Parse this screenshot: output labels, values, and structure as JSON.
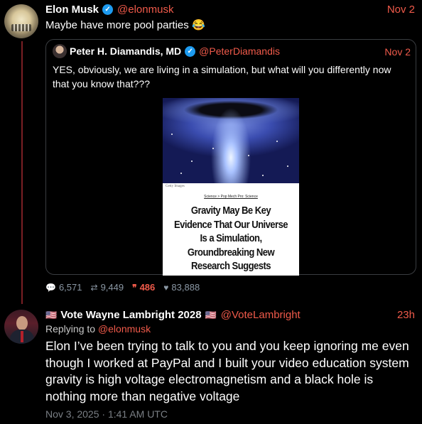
{
  "colors": {
    "accent": "#f05a4a",
    "verified": "#1d9bf0",
    "thread_line": "#7a1f24"
  },
  "main_post": {
    "name": "Elon Musk",
    "handle": "@elonmusk",
    "date": "Nov 2",
    "text": "Maybe have more pool parties 😂"
  },
  "quoted_post": {
    "name": "Peter H. Diamandis, MD",
    "handle": "@PeterDiamandis",
    "date": "Nov 2",
    "text": "YES, obviously, we are living in a simulation, but what will you differently now that you know that???",
    "article": {
      "credit": "Getty Images",
      "breadcrumb": "Science > Pop Mech Pro: Science",
      "headline": "Gravity May Be Key Evidence That Our Universe Is a Simulation, Groundbreaking New Research Suggests"
    }
  },
  "stats": {
    "replies": "6,571",
    "reposts": "9,449",
    "quotes": "486",
    "likes": "83,888"
  },
  "reply_post": {
    "flag_left": "🇺🇸",
    "name": "Vote Wayne Lambright 2028",
    "flag_right": "🇺🇸",
    "handle": "@VoteLambright",
    "date": "23h",
    "replying_to_prefix": "Replying to",
    "replying_to_handle": "@elonmusk",
    "text": "Elon I’ve been trying to talk to you and you keep ignoring me even though I worked at PayPal and I built your video education system gravity is high voltage electromagnetism and a black hole is nothing more than negative voltage",
    "timestamp": "Nov 3, 2025 · 1:41 AM UTC"
  },
  "icons": {
    "reply": "comment-icon",
    "repost": "repost-icon",
    "quote": "quote-icon",
    "like": "heart-icon",
    "verified": "verified-badge-icon"
  }
}
